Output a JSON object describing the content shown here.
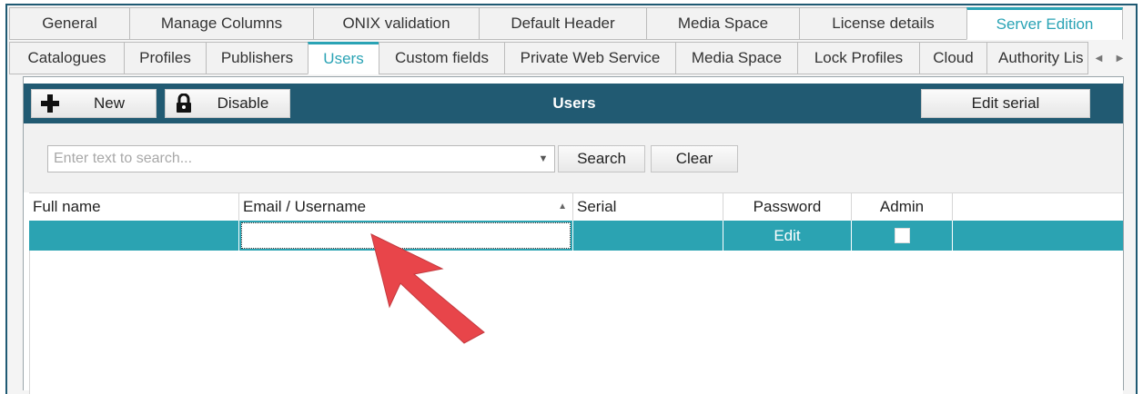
{
  "tabs_row1": [
    {
      "label": "General",
      "active": false
    },
    {
      "label": "Manage Columns",
      "active": false
    },
    {
      "label": "ONIX validation",
      "active": false
    },
    {
      "label": "Default Header",
      "active": false
    },
    {
      "label": "Media Space",
      "active": false
    },
    {
      "label": "License details",
      "active": false
    },
    {
      "label": "Server Edition",
      "active": true
    }
  ],
  "tabs_row2": [
    {
      "label": "Catalogues",
      "active": false
    },
    {
      "label": "Profiles",
      "active": false
    },
    {
      "label": "Publishers",
      "active": false
    },
    {
      "label": "Users",
      "active": true
    },
    {
      "label": "Custom fields",
      "active": false
    },
    {
      "label": "Private Web Service",
      "active": false
    },
    {
      "label": "Media Space",
      "active": false
    },
    {
      "label": "Lock Profiles",
      "active": false
    },
    {
      "label": "Cloud",
      "active": false
    },
    {
      "label": "Authority Lis",
      "active": false
    }
  ],
  "toolbar": {
    "title": "Users",
    "new_label": "New",
    "disable_label": "Disable",
    "edit_serial_label": "Edit serial"
  },
  "search": {
    "placeholder": "Enter text to search...",
    "search_label": "Search",
    "clear_label": "Clear"
  },
  "grid": {
    "columns": [
      "Full name",
      "Email / Username",
      "Serial",
      "Password",
      "Admin"
    ],
    "sort_column": "Email / Username",
    "rows": [
      {
        "full_name": "",
        "email": "",
        "serial": "",
        "password_action": "Edit",
        "admin": false
      }
    ]
  },
  "colors": {
    "toolbar_bg": "#215a72",
    "selected_row": "#2ba3b2",
    "active_tab_text": "#2aa3b5",
    "arrow": "#e8454a"
  }
}
